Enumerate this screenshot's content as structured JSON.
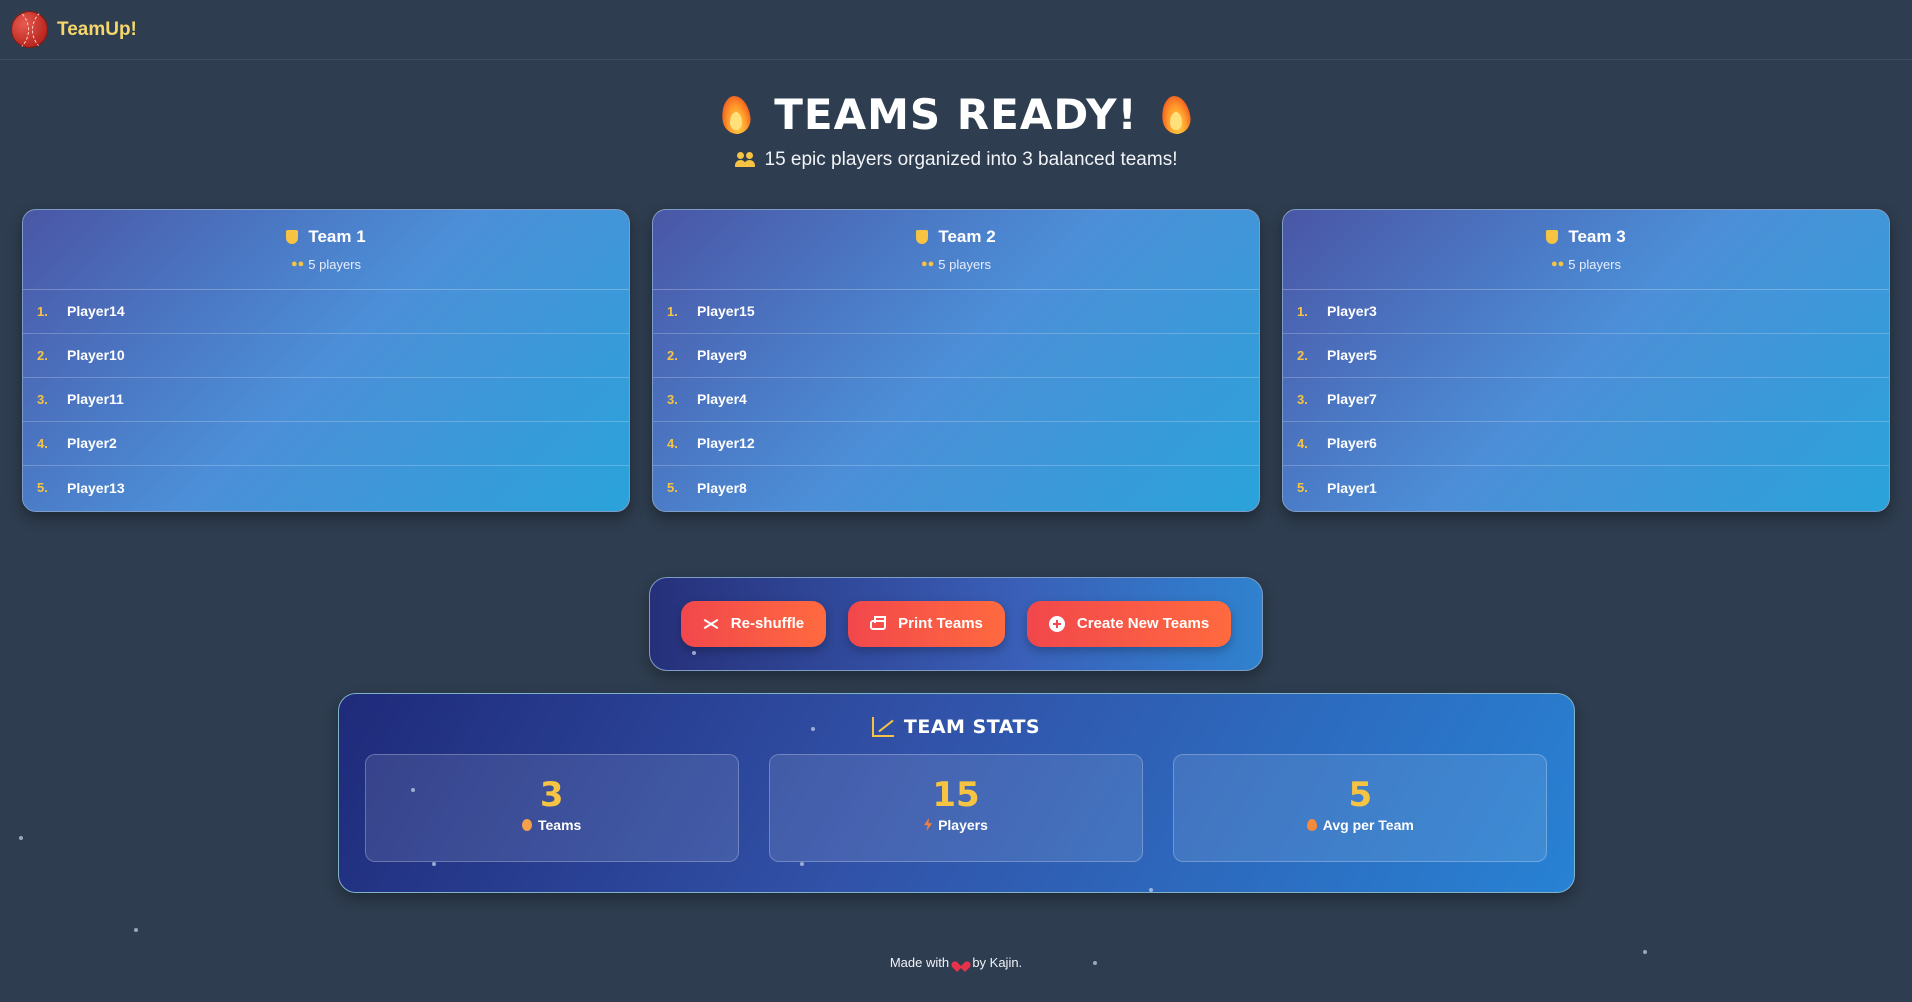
{
  "navbar": {
    "brand": "TeamUp!"
  },
  "hero": {
    "title": "TEAMS READY!",
    "subtitle": "15 epic players organized into 3 balanced teams!"
  },
  "teams": [
    {
      "name": "Team 1",
      "count": "5 players",
      "players": [
        "Player14",
        "Player10",
        "Player11",
        "Player2",
        "Player13"
      ]
    },
    {
      "name": "Team 2",
      "count": "5 players",
      "players": [
        "Player15",
        "Player9",
        "Player4",
        "Player12",
        "Player8"
      ]
    },
    {
      "name": "Team 3",
      "count": "5 players",
      "players": [
        "Player3",
        "Player5",
        "Player7",
        "Player6",
        "Player1"
      ]
    }
  ],
  "actions": {
    "reshuffle": "Re-shuffle",
    "print": "Print Teams",
    "create": "Create New Teams"
  },
  "stats": {
    "title": "TEAM STATS",
    "items": [
      {
        "value": "3",
        "label": "Teams"
      },
      {
        "value": "15",
        "label": "Players"
      },
      {
        "value": "5",
        "label": "Avg per Team"
      }
    ]
  },
  "footer": {
    "prefix": "Made with",
    "suffix": "by Kajin."
  },
  "colors": {
    "background": "#2e3d4f",
    "accent_yellow": "#f6c343",
    "button_red": "#f2474c",
    "brand_yellow": "#f5d66b"
  }
}
